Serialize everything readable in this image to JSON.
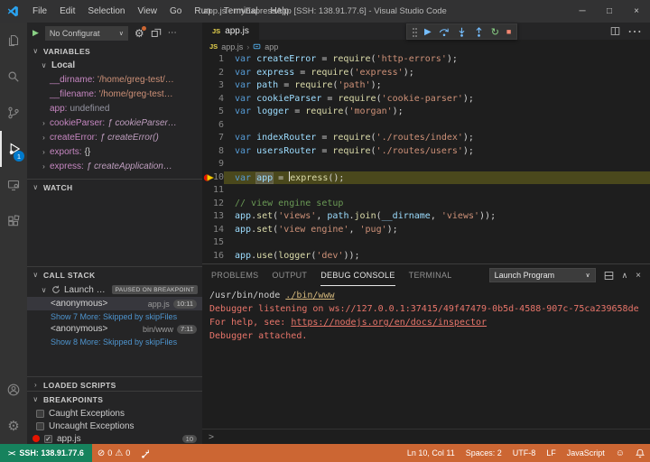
{
  "title_bar": {
    "menus": [
      "File",
      "Edit",
      "Selection",
      "View",
      "Go",
      "Run",
      "Terminal",
      "Help"
    ],
    "title": "app.js - myExpressApp [SSH: 138.91.77.6] - Visual Studio Code",
    "window_controls": {
      "minimize": "─",
      "maximize": "□",
      "close": "×"
    }
  },
  "activity_bar": {
    "items": [
      "files-icon",
      "search-icon",
      "source-control-icon",
      "run-and-debug-icon",
      "remote-explorer-icon",
      "extensions-icon"
    ],
    "active_item": "run-and-debug-icon",
    "debug_badge": "1",
    "bottom": [
      "accounts-icon",
      "settings-gear-icon"
    ]
  },
  "sidebar": {
    "toolbar": {
      "config_label": "No Configurat",
      "chevron": "∨",
      "play": "▶",
      "gear": "⚙",
      "more": "⋯"
    },
    "variables": {
      "header": "VARIABLES",
      "scope": "Local",
      "rows": [
        {
          "twisty": "",
          "key": "__dirname",
          "value": "'/home/greg-test/…",
          "vt": "str"
        },
        {
          "twisty": "",
          "key": "__filename",
          "value": "'/home/greg-test…",
          "vt": "str"
        },
        {
          "twisty": "",
          "key": "app",
          "value": "undefined",
          "vt": "ud"
        },
        {
          "twisty": "›",
          "key": "cookieParser",
          "value": "ƒ cookieParser…",
          "vt": "fn"
        },
        {
          "twisty": "›",
          "key": "createError",
          "value": "ƒ createError()",
          "vt": "fn"
        },
        {
          "twisty": "›",
          "key": "exports",
          "value": "{}",
          "vt": "p"
        },
        {
          "twisty": "›",
          "key": "express",
          "value": "ƒ createApplication…",
          "vt": "fn"
        }
      ]
    },
    "watch": {
      "header": "WATCH"
    },
    "call_stack": {
      "header": "CALL STACK",
      "session": {
        "label": "Launch …",
        "badge": "PAUSED ON BREAKPOINT"
      },
      "frames": [
        {
          "name": "<anonymous>",
          "file": "app.js",
          "pos": "10:11",
          "selected": true
        },
        {
          "link": "Show 7 More: Skipped by skipFiles"
        },
        {
          "name": "<anonymous>",
          "file": "bin/www",
          "pos": "7:11"
        },
        {
          "link": "Show 8 More: Skipped by skipFiles"
        }
      ]
    },
    "loaded_scripts": {
      "header": "LOADED SCRIPTS"
    },
    "breakpoints": {
      "header": "BREAKPOINTS",
      "items": [
        {
          "checked": false,
          "dot": false,
          "label": "Caught Exceptions"
        },
        {
          "checked": false,
          "dot": false,
          "label": "Uncaught Exceptions"
        },
        {
          "checked": true,
          "dot": true,
          "label": "app.js",
          "badge": "10"
        }
      ]
    }
  },
  "editor": {
    "tab": "app.js",
    "tab_icon": "JS",
    "breadcrumb": {
      "file": "app.js",
      "sep": "›",
      "symbol": "app"
    },
    "lines": [
      {
        "num": 1,
        "tokens": [
          {
            "t": "kw",
            "s": "var "
          },
          {
            "t": "v",
            "s": "createError"
          },
          {
            "t": "p",
            "s": " = "
          },
          {
            "t": "fn",
            "s": "require"
          },
          {
            "t": "p",
            "s": "("
          },
          {
            "t": "s",
            "s": "'http-errors'"
          },
          {
            "t": "p",
            "s": ");"
          }
        ]
      },
      {
        "num": 2,
        "tokens": [
          {
            "t": "kw",
            "s": "var "
          },
          {
            "t": "v",
            "s": "express"
          },
          {
            "t": "p",
            "s": " = "
          },
          {
            "t": "fn",
            "s": "require"
          },
          {
            "t": "p",
            "s": "("
          },
          {
            "t": "s",
            "s": "'express'"
          },
          {
            "t": "p",
            "s": ");"
          }
        ]
      },
      {
        "num": 3,
        "tokens": [
          {
            "t": "kw",
            "s": "var "
          },
          {
            "t": "v",
            "s": "path"
          },
          {
            "t": "p",
            "s": " = "
          },
          {
            "t": "fn",
            "s": "require"
          },
          {
            "t": "p",
            "s": "("
          },
          {
            "t": "s",
            "s": "'path'"
          },
          {
            "t": "p",
            "s": ");"
          }
        ]
      },
      {
        "num": 4,
        "tokens": [
          {
            "t": "kw",
            "s": "var "
          },
          {
            "t": "v",
            "s": "cookieParser"
          },
          {
            "t": "p",
            "s": " = "
          },
          {
            "t": "fn",
            "s": "require"
          },
          {
            "t": "p",
            "s": "("
          },
          {
            "t": "s",
            "s": "'cookie-parser'"
          },
          {
            "t": "p",
            "s": ");"
          }
        ]
      },
      {
        "num": 5,
        "tokens": [
          {
            "t": "kw",
            "s": "var "
          },
          {
            "t": "v",
            "s": "logger"
          },
          {
            "t": "p",
            "s": " = "
          },
          {
            "t": "fn",
            "s": "require"
          },
          {
            "t": "p",
            "s": "("
          },
          {
            "t": "s",
            "s": "'morgan'"
          },
          {
            "t": "p",
            "s": ");"
          }
        ]
      },
      {
        "num": 6,
        "tokens": []
      },
      {
        "num": 7,
        "tokens": [
          {
            "t": "kw",
            "s": "var "
          },
          {
            "t": "v",
            "s": "indexRouter"
          },
          {
            "t": "p",
            "s": " = "
          },
          {
            "t": "fn",
            "s": "require"
          },
          {
            "t": "p",
            "s": "("
          },
          {
            "t": "s",
            "s": "'./routes/index'"
          },
          {
            "t": "p",
            "s": ");"
          }
        ]
      },
      {
        "num": 8,
        "tokens": [
          {
            "t": "kw",
            "s": "var "
          },
          {
            "t": "v",
            "s": "usersRouter"
          },
          {
            "t": "p",
            "s": " = "
          },
          {
            "t": "fn",
            "s": "require"
          },
          {
            "t": "p",
            "s": "("
          },
          {
            "t": "s",
            "s": "'./routes/users'"
          },
          {
            "t": "p",
            "s": ");"
          }
        ]
      },
      {
        "num": 9,
        "tokens": []
      },
      {
        "num": 10,
        "current": true,
        "tokens": [
          {
            "t": "kw",
            "s": "var "
          },
          {
            "t": "v",
            "s": "app",
            "sel": true
          },
          {
            "t": "p",
            "s": " = "
          },
          {
            "t": "cursor",
            "s": ""
          },
          {
            "t": "fn",
            "s": "express"
          },
          {
            "t": "p",
            "s": "();"
          }
        ]
      },
      {
        "num": 11,
        "tokens": []
      },
      {
        "num": 12,
        "tokens": [
          {
            "t": "cm",
            "s": "// view engine setup"
          }
        ]
      },
      {
        "num": 13,
        "tokens": [
          {
            "t": "v",
            "s": "app"
          },
          {
            "t": "p",
            "s": "."
          },
          {
            "t": "fn",
            "s": "set"
          },
          {
            "t": "p",
            "s": "("
          },
          {
            "t": "s",
            "s": "'views'"
          },
          {
            "t": "p",
            "s": ", "
          },
          {
            "t": "v",
            "s": "path"
          },
          {
            "t": "p",
            "s": "."
          },
          {
            "t": "fn",
            "s": "join"
          },
          {
            "t": "p",
            "s": "("
          },
          {
            "t": "v",
            "s": "__dirname"
          },
          {
            "t": "p",
            "s": ", "
          },
          {
            "t": "s",
            "s": "'views'"
          },
          {
            "t": "p",
            "s": "));"
          }
        ]
      },
      {
        "num": 14,
        "tokens": [
          {
            "t": "v",
            "s": "app"
          },
          {
            "t": "p",
            "s": "."
          },
          {
            "t": "fn",
            "s": "set"
          },
          {
            "t": "p",
            "s": "("
          },
          {
            "t": "s",
            "s": "'view engine'"
          },
          {
            "t": "p",
            "s": ", "
          },
          {
            "t": "s",
            "s": "'pug'"
          },
          {
            "t": "p",
            "s": ");"
          }
        ]
      },
      {
        "num": 15,
        "tokens": []
      },
      {
        "num": 16,
        "tokens": [
          {
            "t": "v",
            "s": "app"
          },
          {
            "t": "p",
            "s": "."
          },
          {
            "t": "fn",
            "s": "use"
          },
          {
            "t": "p",
            "s": "("
          },
          {
            "t": "fn",
            "s": "logger"
          },
          {
            "t": "p",
            "s": "("
          },
          {
            "t": "s",
            "s": "'dev'"
          },
          {
            "t": "p",
            "s": "));"
          }
        ]
      }
    ]
  },
  "panel": {
    "tabs": [
      {
        "label": "PROBLEMS",
        "active": false
      },
      {
        "label": "OUTPUT",
        "active": false
      },
      {
        "label": "DEBUG CONSOLE",
        "active": true
      },
      {
        "label": "TERMINAL",
        "active": false
      }
    ],
    "dropdown": "Launch Program",
    "console": [
      {
        "parts": [
          {
            "t": "plain",
            "s": "/usr/bin/node "
          },
          {
            "t": "link-yellow",
            "s": "./bin/www"
          }
        ]
      },
      {
        "parts": [
          {
            "t": "err",
            "s": "Debugger listening on ws://127.0.0.1:37415/49f47479-0b5d-4588-907c-75ca239658de"
          }
        ]
      },
      {
        "parts": [
          {
            "t": "err",
            "s": "For help, see: "
          },
          {
            "t": "link-err",
            "s": "https://nodejs.org/en/docs/inspector"
          }
        ]
      },
      {
        "parts": [
          {
            "t": "err",
            "s": "Debugger attached."
          }
        ]
      }
    ],
    "prompt": ">"
  },
  "status_bar": {
    "remote_label": "SSH: 138.91.77.6",
    "errors": "0",
    "warnings": "0",
    "right_items": [
      "Ln 10, Col 11",
      "Spaces: 2",
      "UTF-8",
      "LF",
      "JavaScript"
    ]
  },
  "colors": {
    "statusbar_debug": "#cc6633",
    "remote_green": "#16825d",
    "activity_badge_blue": "#007acc",
    "breakpoint_red": "#e51400",
    "current_line": "#4a481c",
    "tab_js_icon": "#e8d44d"
  }
}
